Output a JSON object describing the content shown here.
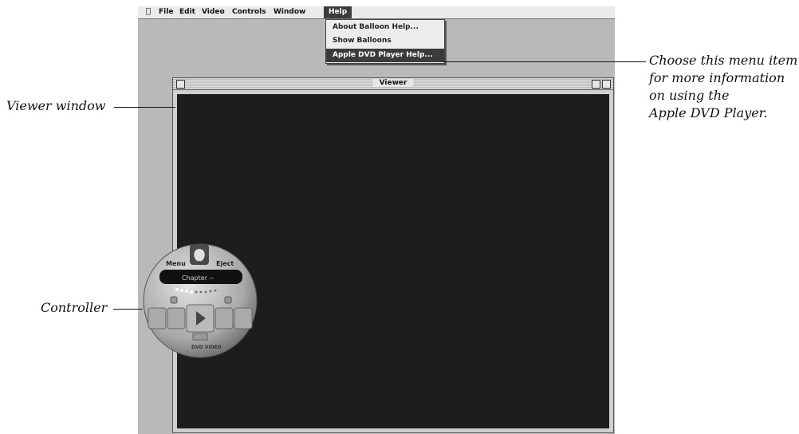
{
  "menubar": {
    "items": [
      "File",
      "Edit",
      "Video",
      "Controls",
      "Window",
      "Help"
    ]
  },
  "help_menu": {
    "items": [
      "About Balloon Help...",
      "Show Balloons",
      "Apple DVD Player Help..."
    ]
  },
  "viewer": {
    "title": "Viewer"
  },
  "controller": {
    "menu_label": "Menu",
    "eject_label": "Eject",
    "chapter_label": "Chapter --",
    "logo_text": "DVD VIDEO"
  },
  "callouts": {
    "viewer_window": "Viewer window",
    "controller": "Controller",
    "help_menu_lines": [
      "Choose this menu item",
      "for more information",
      "on using the",
      "Apple DVD Player."
    ]
  }
}
